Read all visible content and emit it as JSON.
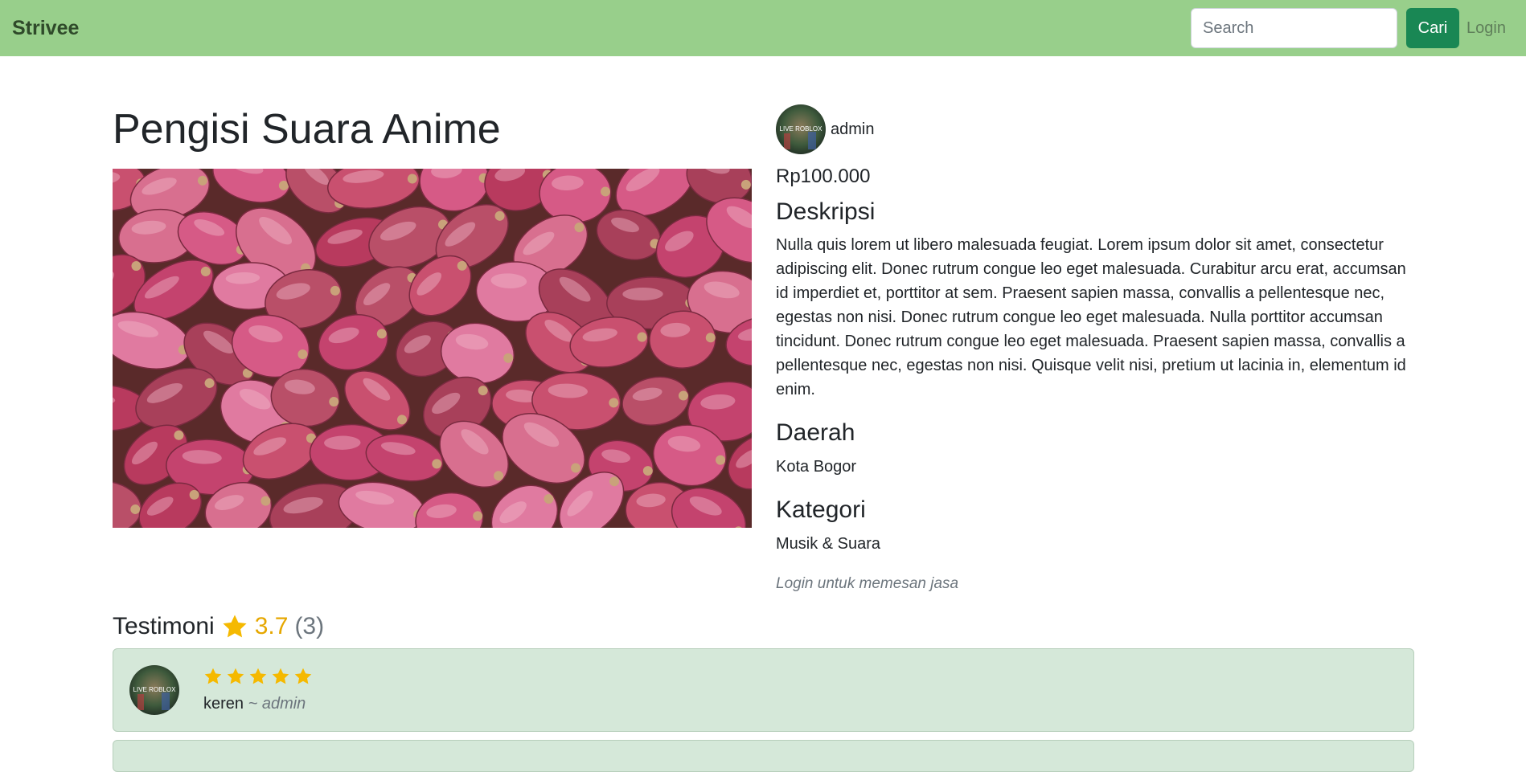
{
  "navbar": {
    "brand": "Strivee",
    "search_placeholder": "Search",
    "search_button": "Cari",
    "login": "Login",
    "color": "#98cf8b"
  },
  "product": {
    "title": "Pengisi Suara Anime",
    "image_icon": "shallots-photo",
    "seller_avatar_text": "LIVE ROBLOX",
    "seller_name": "admin",
    "price": "Rp100.000",
    "desc_heading": "Deskripsi",
    "description": "Nulla quis lorem ut libero malesuada feugiat. Lorem ipsum dolor sit amet, consectetur adipiscing elit. Donec rutrum congue leo eget malesuada. Curabitur arcu erat, accumsan id imperdiet et, porttitor at sem. Praesent sapien massa, convallis a pellentesque nec, egestas non nisi. Donec rutrum congue leo eget malesuada. Nulla porttitor accumsan tincidunt. Donec rutrum congue leo eget malesuada. Praesent sapien massa, convallis a pellentesque nec, egestas non nisi. Quisque velit nisi, pretium ut lacinia in, elementum id enim.",
    "region_heading": "Daerah",
    "region": "Kota Bogor",
    "category_heading": "Kategori",
    "category": "Musik & Suara",
    "login_note": "Login untuk memesan jasa"
  },
  "testimonials": {
    "heading": "Testimoni",
    "rating": "3.7",
    "count": "(3)",
    "star_color": "#f5b900",
    "items": [
      {
        "avatar_text": "LIVE ROBLOX",
        "stars": 5,
        "text": "keren",
        "author": "~ admin"
      }
    ]
  }
}
